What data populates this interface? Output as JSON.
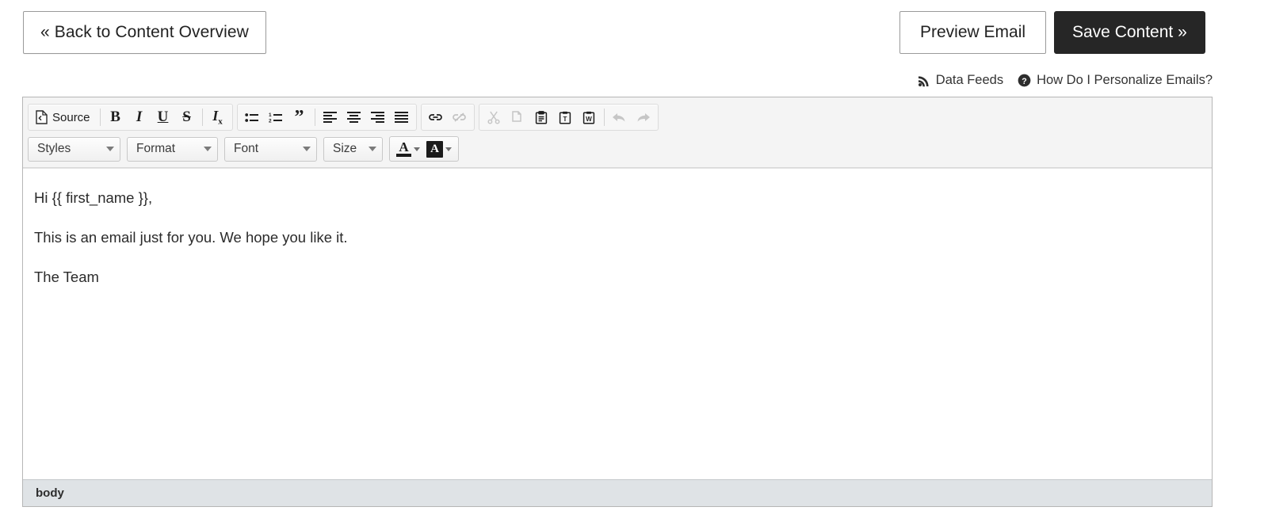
{
  "topbar": {
    "back_label": "« Back to Content Overview",
    "preview_label": "Preview Email",
    "save_label": "Save Content »",
    "save_bg": "#262626"
  },
  "helplinks": [
    {
      "label": "Data Feeds",
      "icon": "rss-icon"
    },
    {
      "label": "How Do I Personalize Emails?",
      "icon": "question-circle-icon"
    }
  ],
  "toolbar": {
    "row1": {
      "source_label": "Source",
      "bold": "B",
      "italic": "I",
      "underline": "U",
      "strike": "S",
      "remove_format": "Tx"
    },
    "row2": {
      "styles": "Styles",
      "format": "Format",
      "font": "Font",
      "size": "Size"
    }
  },
  "editor": {
    "paragraphs": [
      "Hi {{ first_name }},",
      "This is an email just for you. We hope you like it.",
      "The Team"
    ],
    "status_path": "body"
  }
}
